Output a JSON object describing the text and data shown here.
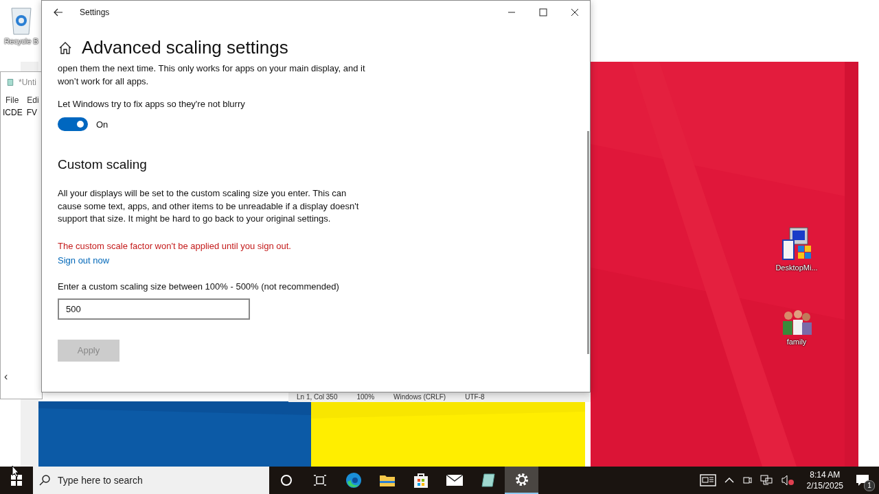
{
  "desktop": {
    "icons": [
      {
        "kind": "recycle",
        "label": "Recycle B"
      },
      {
        "kind": "installer",
        "label": "DesktopMi..."
      },
      {
        "kind": "people",
        "label": "family"
      }
    ]
  },
  "notepad": {
    "title": "*Unti",
    "menu": [
      "File",
      "Edi"
    ],
    "content": [
      "ICDE",
      "FV"
    ],
    "scroll_arrow": "‹",
    "status": [
      "Ln 1, Col 350",
      "100%",
      "Windows (CRLF)",
      "UTF-8"
    ]
  },
  "settings": {
    "window": {
      "title": "Settings"
    },
    "page_title": "Advanced scaling settings",
    "intro": "open them the next time. This only works for apps on your main display, and it won’t work for all apps.",
    "fix_toggle": {
      "label": "Let Windows try to fix apps so they're not blurry",
      "on": true,
      "state_text": "On"
    },
    "custom_scaling": {
      "heading": "Custom scaling",
      "description": "All your displays will be set to the custom scaling size you enter. This can cause some text, apps, and other items to be unreadable if a display doesn't support that size. It might be hard to go back to your original settings.",
      "warning": "The custom scale factor won't be applied until you sign out.",
      "link": "Sign out now",
      "field_label": "Enter a custom scaling size between 100% - 500% (not recommended)",
      "field_value": "500",
      "apply": {
        "label": "Apply",
        "disabled": true
      }
    }
  },
  "taskbar": {
    "search": {
      "placeholder": "Type here to search"
    },
    "apps": [
      {
        "kind": "cortana",
        "selected": false
      },
      {
        "kind": "taskview",
        "selected": false
      },
      {
        "kind": "edge",
        "selected": false
      },
      {
        "kind": "explorer",
        "selected": false
      },
      {
        "kind": "store",
        "selected": false
      },
      {
        "kind": "mail",
        "selected": false
      },
      {
        "kind": "notepad",
        "selected": false
      },
      {
        "kind": "settings",
        "selected": true
      }
    ],
    "time": "8:14 AM",
    "date": "2/15/2025",
    "notification_count": "1"
  }
}
